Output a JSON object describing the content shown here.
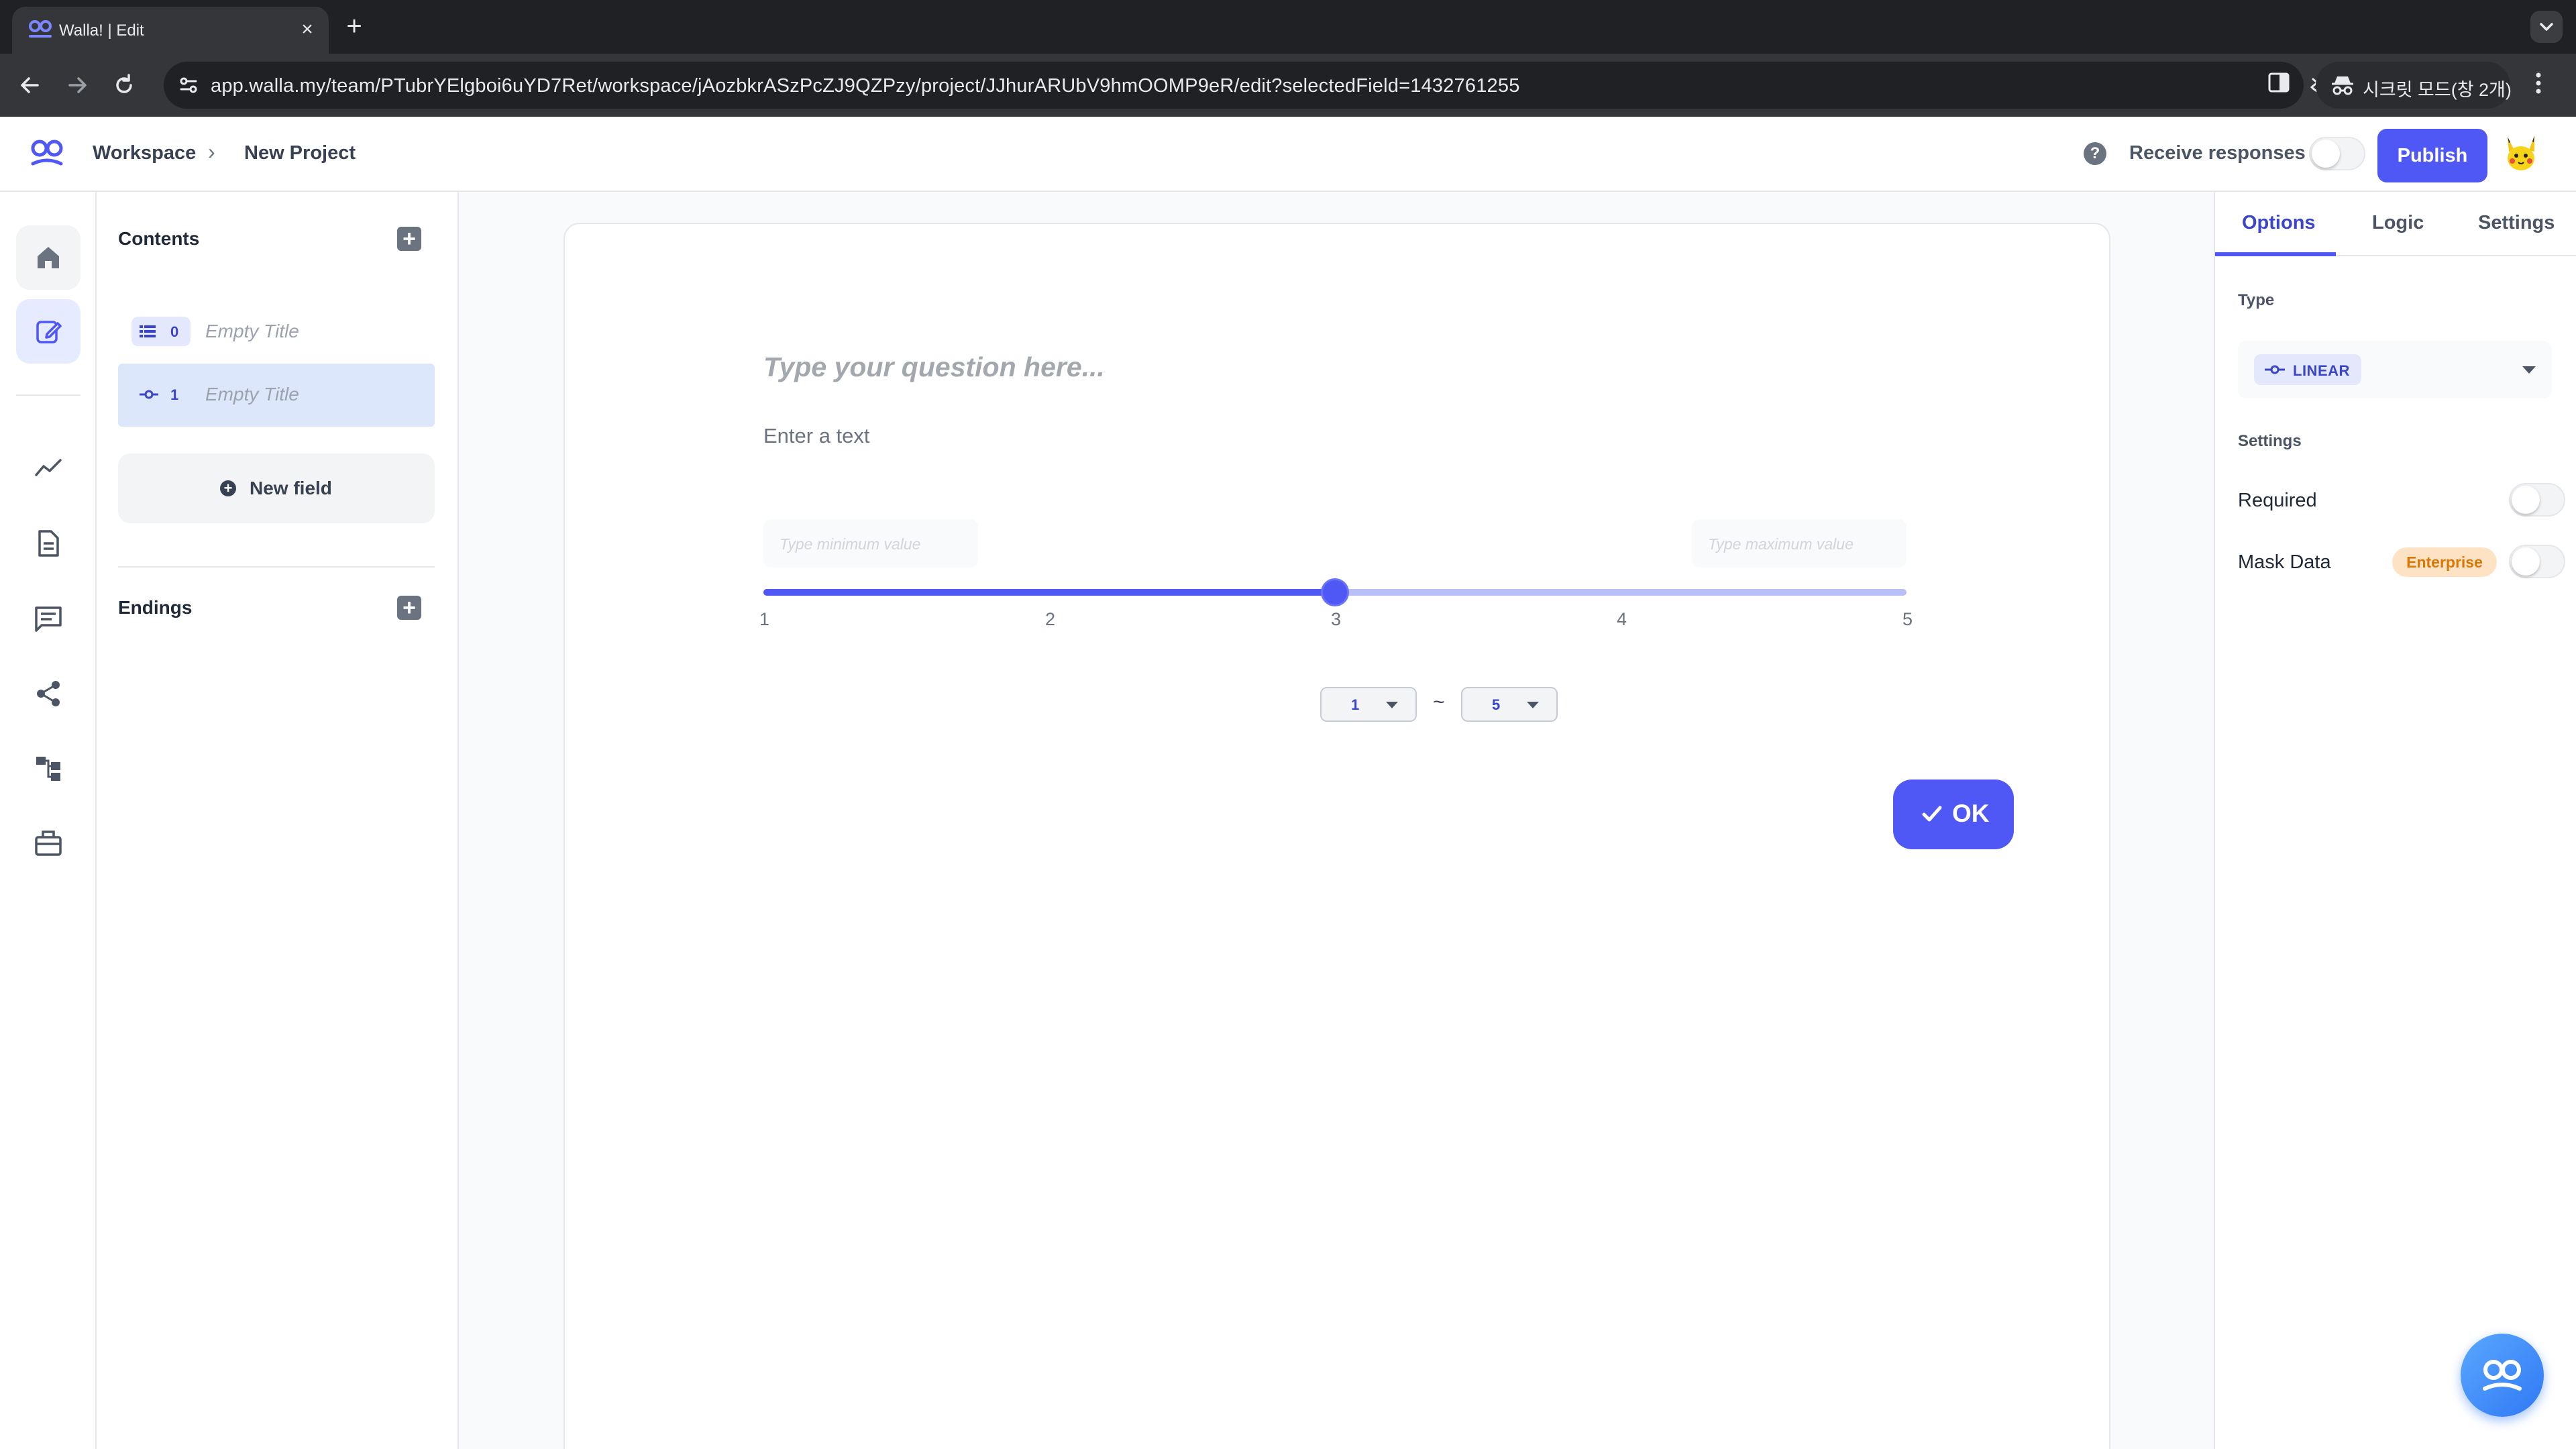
{
  "browser": {
    "tab_title": "Walla! | Edit",
    "url": "app.walla.my/team/PTubrYElgboi6uYD7Ret/workspace/jAozbkrASzPcZJ9QZPzy/project/JJhurARUbV9hmOOMP9eR/edit?selectedField=1432761255",
    "incognito_label": "시크릿 모드(창 2개)"
  },
  "header": {
    "breadcrumb": [
      "Workspace",
      "New Project"
    ],
    "receive_label": "Receive responses",
    "receive_enabled": false,
    "publish_label": "Publish"
  },
  "rail": {
    "items": [
      "home-icon",
      "edit-icon",
      "analytics-icon",
      "document-icon",
      "chat-icon",
      "share-icon",
      "flow-icon",
      "integrations-icon"
    ],
    "active": "edit-icon"
  },
  "contents": {
    "title": "Contents",
    "fields": [
      {
        "index": "0",
        "title": "Empty Title",
        "icon": "list-icon"
      },
      {
        "index": "1",
        "title": "Empty Title",
        "icon": "linear-scale-icon",
        "selected": true
      }
    ],
    "new_field_label": "New field",
    "endings_title": "Endings"
  },
  "editor": {
    "question_placeholder": "Type your question here...",
    "description_placeholder": "Enter a text",
    "min_placeholder": "Type minimum value",
    "max_placeholder": "Type maximum value",
    "scale": {
      "ticks": [
        "1",
        "2",
        "3",
        "4",
        "5"
      ],
      "value": 3,
      "from": "1",
      "to": "5",
      "separator": "~"
    },
    "ok_label": "OK"
  },
  "options": {
    "tabs": [
      "Options",
      "Logic",
      "Settings"
    ],
    "active_tab": "Options",
    "type_label": "Type",
    "type_value": "LINEAR",
    "settings_label": "Settings",
    "required_label": "Required",
    "required_enabled": false,
    "mask_label": "Mask Data",
    "mask_badge": "Enterprise",
    "mask_enabled": false
  },
  "colors": {
    "accent": "#4f57f5",
    "accent_light": "#b9bff7",
    "selected_bg": "#dde7fb",
    "enterprise_bg": "#fde3c4",
    "enterprise_text": "#d97706"
  }
}
